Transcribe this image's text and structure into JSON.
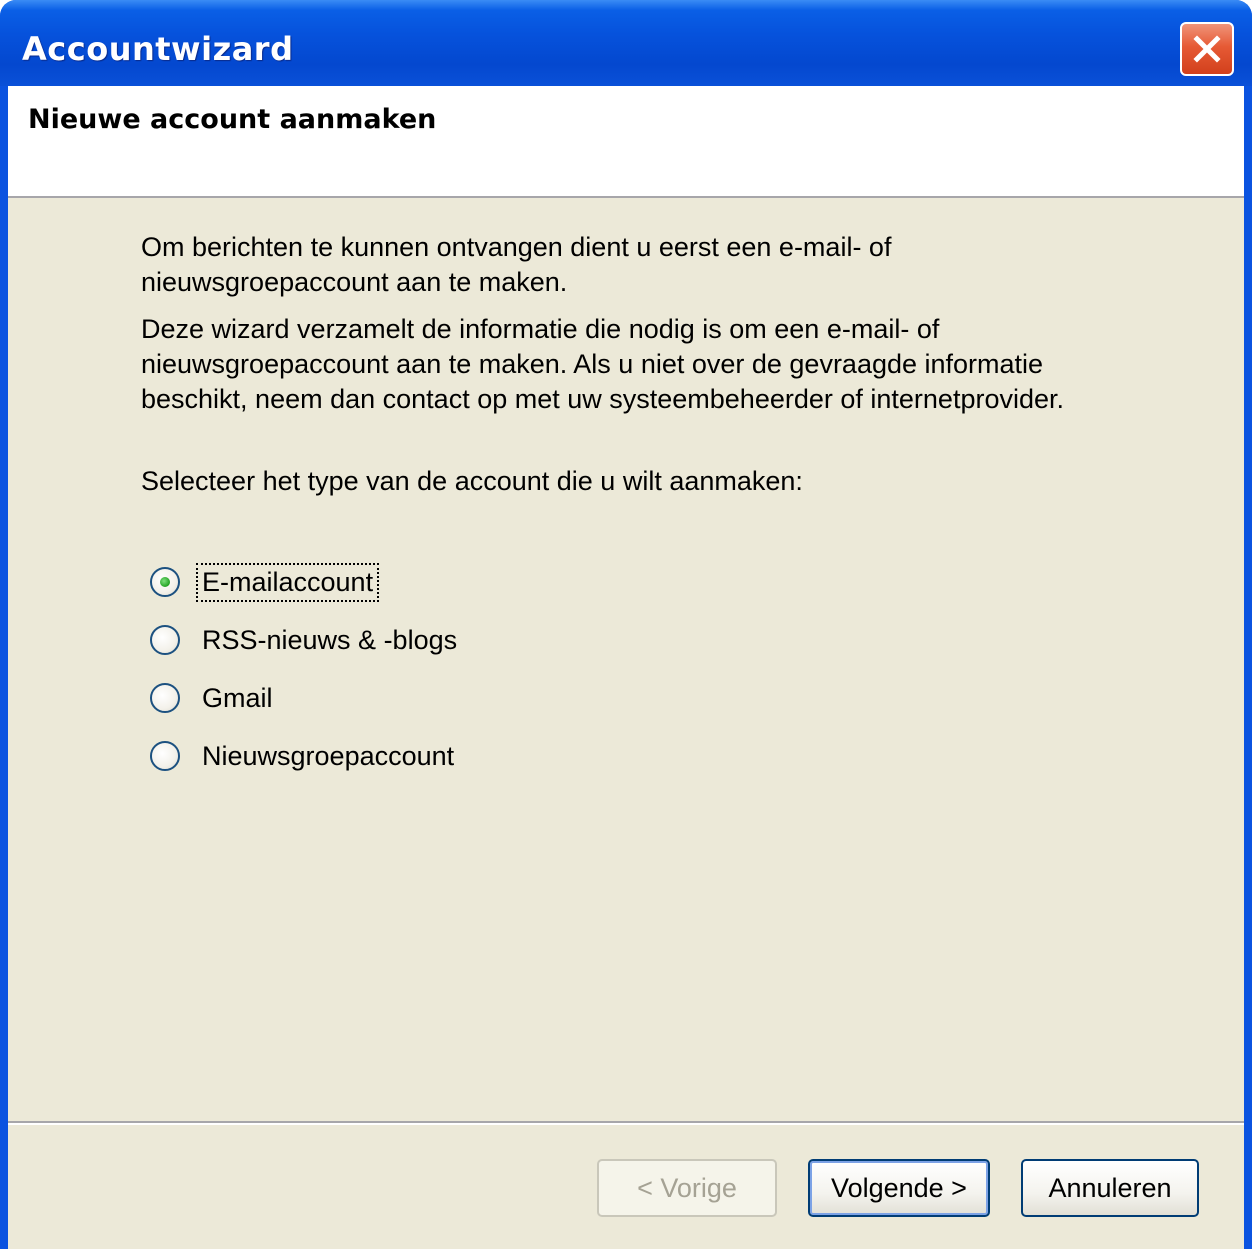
{
  "window": {
    "title": "Accountwizard"
  },
  "header": {
    "title": "Nieuwe account aanmaken"
  },
  "body": {
    "paragraph1": "Om berichten te kunnen ontvangen dient u eerst een e-mail- of nieuwsgroepaccount aan te maken.",
    "paragraph2": "Deze wizard verzamelt de informatie die nodig is om een e-mail- of nieuwsgroepaccount aan te maken. Als u niet over de gevraagde informatie beschikt, neem dan contact op met uw systeembeheerder of internetprovider.",
    "prompt": "Selecteer het type van de account die u wilt aanmaken:"
  },
  "account_types": [
    {
      "label": "E-mailaccount",
      "selected": true
    },
    {
      "label": "RSS-nieuws & -blogs",
      "selected": false
    },
    {
      "label": "Gmail",
      "selected": false
    },
    {
      "label": "Nieuwsgroepaccount",
      "selected": false
    }
  ],
  "buttons": {
    "back_label": "< Vorige",
    "next_label": "Volgende >",
    "cancel_label": "Annuleren"
  },
  "colors": {
    "titlebar": "#0652dc",
    "dialog_bg": "#ece9d8",
    "close_button": "#e65a35",
    "radio_selected": "#21a121"
  }
}
